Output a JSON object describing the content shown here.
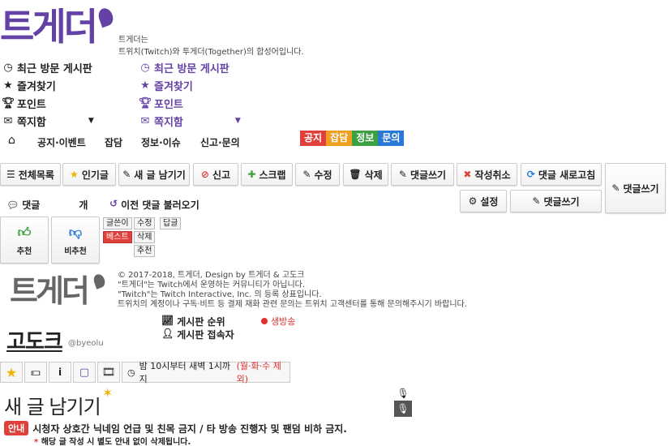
{
  "logo": {
    "text": "트게더",
    "footer_text": "트게더"
  },
  "intro": {
    "line1": "트게더는",
    "line2": "트위치(Twitch)와 투게더(Together)의 합성어입니다."
  },
  "menu_left": [
    {
      "icon": "clock-icon",
      "label": "최근 방문 게시판"
    },
    {
      "icon": "star-icon",
      "label": "즐겨찾기"
    },
    {
      "icon": "trophy-icon",
      "label": "포인트"
    },
    {
      "icon": "envelope-icon",
      "label": "쪽지함"
    }
  ],
  "menu_right": [
    {
      "icon": "clock-icon",
      "label": "최근 방문 게시판"
    },
    {
      "icon": "star-icon",
      "label": "즐겨찾기"
    },
    {
      "icon": "trophy-icon",
      "label": "포인트"
    },
    {
      "icon": "envelope-icon",
      "label": "쪽지함"
    }
  ],
  "nav": {
    "items": [
      "공지·이벤트",
      "잡담",
      "정보·이슈",
      "신고·문의"
    ]
  },
  "tags": [
    {
      "label": "공지",
      "color": "#e0403a"
    },
    {
      "label": "잡담",
      "color": "#f0a020"
    },
    {
      "label": "정보",
      "color": "#3aa040"
    },
    {
      "label": "문의",
      "color": "#2878d8"
    }
  ],
  "toolbar": {
    "all_list": "전체목록",
    "popular": "인기글",
    "new_post": "새 글 남기기",
    "report": "신고",
    "scrap": "스크랩",
    "edit": "수정",
    "delete": "삭제",
    "comment_write": "댓글쓰기",
    "cancel_write": "작성취소",
    "refresh_comments": "댓글 새로고침",
    "settings": "설정",
    "comment_write2": "댓글쓰기",
    "comment_write3": "댓글쓰기"
  },
  "comments": {
    "label": "댓글",
    "count_suffix": "개",
    "load_prev": "이전 댓글 불러오기"
  },
  "vote": {
    "up": "추천",
    "down": "비추천"
  },
  "mini": {
    "author": "글쓴이",
    "best": "베스트",
    "edit": "수정",
    "reply": "답글",
    "delete": "삭제",
    "recommend": "추천"
  },
  "footer": {
    "line1": "© 2017-2018, 트게더, Design by 트게더 & 고도크",
    "line2": "\"트게더\"는 Twitch에서 운영하는 커뮤니티가 아닙니다.",
    "line3": "\"Twitch\"는 Twitch Interactive, Inc. 의 등록 상표입니다.",
    "line4": "트위치의 계정이나 구독·비트 등 결제 재화 관련 문의는 트위치 고객센터를 통해 문의해주시기 바랍니다."
  },
  "channel": {
    "name": "고도크",
    "handle": "@byeolu",
    "ranking": "게시판 순위",
    "visitors": "게시판 접속자",
    "live": "생방송",
    "schedule": "밤 10시부터 새벽 1시까지",
    "schedule_except": "(월·화·수 제외)"
  },
  "compose": {
    "title": "새 글 남기기",
    "notice_badge": "안내",
    "notice": "시청자 상호간 닉네임 언급 및 친목 금지 / 타 방송 진행자 및 팬덤 비하 금지.",
    "warning": "* 해당 글 작성 시 별도 안내 없이 삭제됩니다."
  },
  "colors": {
    "brand": "#6441a5",
    "danger": "#e0403a",
    "live": "#e03030"
  }
}
